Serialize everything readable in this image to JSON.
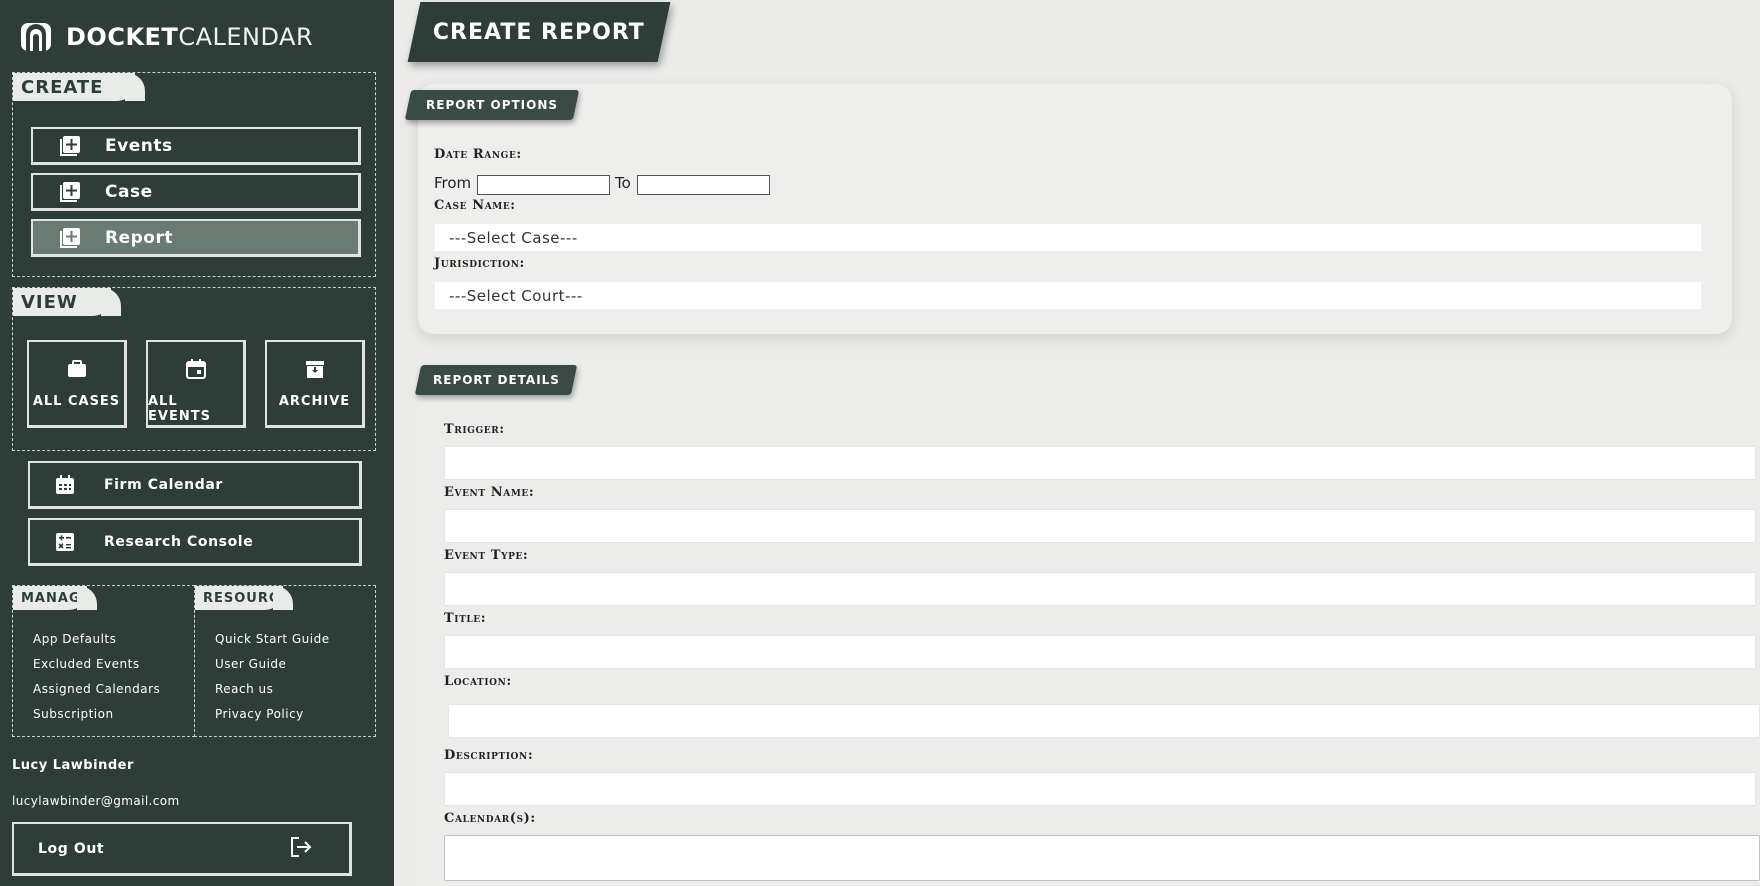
{
  "app": {
    "logo_bold": "DOCKET",
    "logo_light": "CALENDAR"
  },
  "sidebar": {
    "create": {
      "title": "CREATE",
      "items": [
        {
          "label": "Events",
          "icon": "add-box-icon",
          "active": false
        },
        {
          "label": "Case",
          "icon": "add-box-icon",
          "active": false
        },
        {
          "label": "Report",
          "icon": "add-box-icon",
          "active": true
        }
      ]
    },
    "view": {
      "title": "VIEW",
      "items": [
        {
          "label": "ALL CASES",
          "icon": "briefcase-icon"
        },
        {
          "label": "ALL EVENTS",
          "icon": "calendar-icon"
        },
        {
          "label": "ARCHIVE",
          "icon": "archive-icon"
        }
      ]
    },
    "firm_calendar": {
      "label": "Firm Calendar",
      "icon": "calendar-grid-icon"
    },
    "research_console": {
      "label": "Research Console",
      "icon": "calculator-icon"
    },
    "manage": {
      "title": "MANAGE",
      "links": [
        "App Defaults",
        "Excluded Events",
        "Assigned Calendars",
        "Subscription"
      ]
    },
    "resources": {
      "title": "RESOURCES",
      "links": [
        "Quick Start Guide",
        "User Guide",
        "Reach us",
        "Privacy Policy"
      ]
    },
    "user": {
      "name": "Lucy Lawbinder",
      "email": "lucylawbinder@gmail.com"
    },
    "logout": {
      "label": "Log Out",
      "icon": "logout-icon"
    }
  },
  "main": {
    "page_title": "CREATE REPORT",
    "report_options": {
      "title": "REPORT OPTIONS",
      "date_range_label": "Date Range:",
      "from_label": "From",
      "to_label": "To",
      "from_value": "",
      "to_value": "",
      "case_name_label": "Case Name:",
      "case_select": "---Select Case---",
      "jurisdiction_label": "Jurisdiction:",
      "court_select": "---Select Court---"
    },
    "report_details": {
      "title": "REPORT DETAILS",
      "fields": [
        {
          "label": "Trigger:",
          "value": ""
        },
        {
          "label": "Event Name:",
          "value": ""
        },
        {
          "label": "Event Type:",
          "value": ""
        },
        {
          "label": "Title:",
          "value": ""
        },
        {
          "label": "Location:",
          "value": ""
        },
        {
          "label": "Description:",
          "value": ""
        },
        {
          "label": "Calendar(s):",
          "value": ""
        }
      ]
    }
  },
  "colors": {
    "sidebar_bg": "#2e3d38",
    "active_btn": "#6a7b74",
    "content_bg": "#ebecea"
  }
}
